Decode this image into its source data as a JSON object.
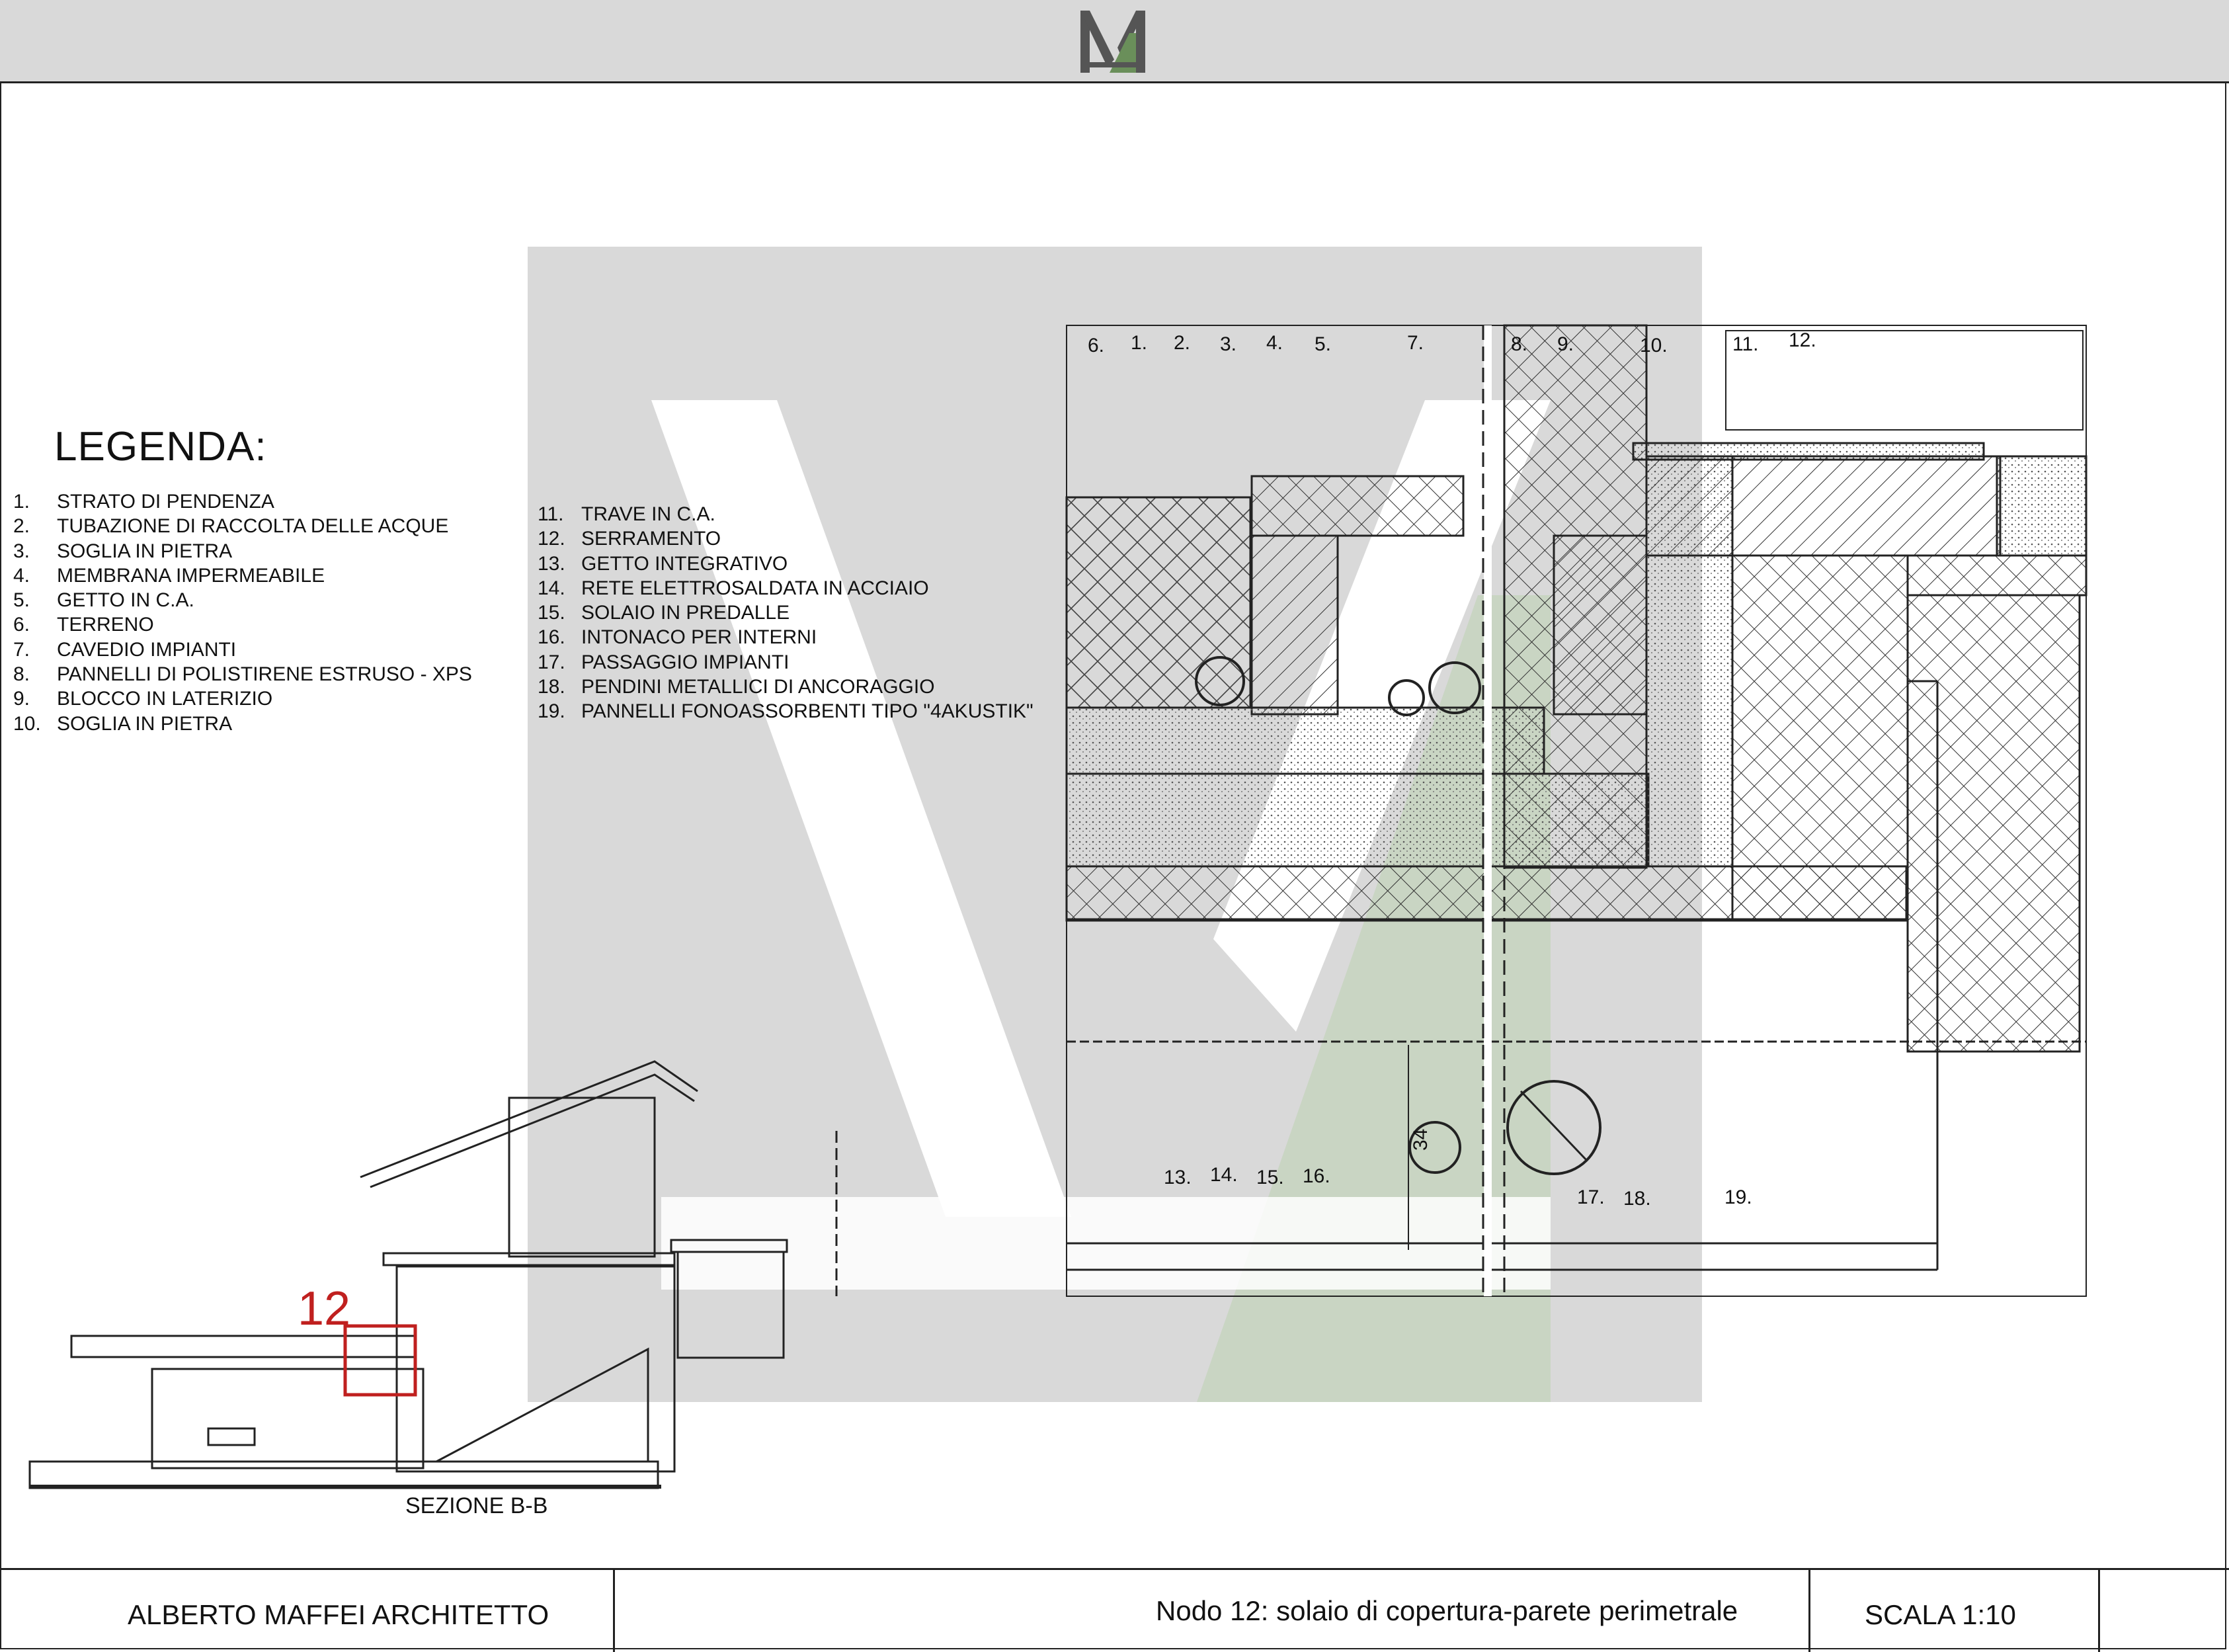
{
  "legend": {
    "title": "LEGENDA:",
    "items_left": [
      {
        "num": "1.",
        "text": "STRATO DI PENDENZA"
      },
      {
        "num": "2.",
        "text": "TUBAZIONE DI RACCOLTA DELLE  ACQUE"
      },
      {
        "num": "3.",
        "text": "SOGLIA IN PIETRA"
      },
      {
        "num": "4.",
        "text": "MEMBRANA IMPERMEABILE"
      },
      {
        "num": "5.",
        "text": "GETTO IN C.A."
      },
      {
        "num": "6.",
        "text": "TERRENO"
      },
      {
        "num": "7.",
        "text": "CAVEDIO IMPIANTI"
      },
      {
        "num": "8.",
        "text": "PANNELLI DI POLISTIRENE ESTRUSO - XPS"
      },
      {
        "num": "9.",
        "text": "BLOCCO IN LATERIZIO"
      },
      {
        "num": "10.",
        "text": "SOGLIA IN PIETRA"
      }
    ],
    "items_right": [
      {
        "num": "11.",
        "text": "TRAVE IN C.A."
      },
      {
        "num": "12.",
        "text": "SERRAMENTO"
      },
      {
        "num": "13.",
        "text": "GETTO INTEGRATIVO"
      },
      {
        "num": "14.",
        "text": "RETE ELETTROSALDATA IN ACCIAIO"
      },
      {
        "num": "15.",
        "text": "SOLAIO IN PREDALLE"
      },
      {
        "num": "16.",
        "text": "INTONACO PER INTERNI"
      },
      {
        "num": "17.",
        "text": "PASSAGGIO IMPIANTI"
      },
      {
        "num": "18.",
        "text": "PENDINI METALLICI DI ANCORAGGIO"
      },
      {
        "num": "19.",
        "text": "PANNELLI FONOASSORBENTI TIPO \"4AKUSTIK\""
      }
    ]
  },
  "detail": {
    "callouts_top": [
      "6.",
      "1.",
      "2.",
      "3.",
      "4.",
      "5.",
      "7.",
      "8.",
      "9.",
      "10.",
      "11.",
      "12."
    ],
    "callouts_bottom": [
      "13.",
      "14.",
      "15.",
      "16.",
      "17.",
      "18.",
      "19."
    ],
    "dimension": "34"
  },
  "section": {
    "node_number": "12",
    "label": "SEZIONE B-B"
  },
  "footer": {
    "author": "ALBERTO MAFFEI ARCHITETTO",
    "drawing_title": "Nodo 12: solaio di copertura-parete perimetrale",
    "scale": "SCALA 1:10"
  },
  "colors": {
    "header_bg": "#d9d9d9",
    "watermark_grey": "#d6d6d6",
    "watermark_green": "#c6d3c0",
    "node_red": "#c0201f"
  }
}
